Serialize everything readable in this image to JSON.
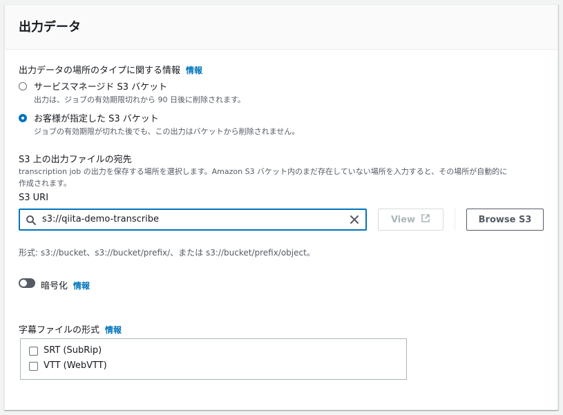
{
  "header": {
    "title": "出力データ"
  },
  "location": {
    "label": "出力データの場所のタイプに関する情報",
    "info": "情報",
    "options": [
      {
        "label": "サービスマネージド S3 バケット",
        "description": "出力は、ジョブの有効期限切れから 90 日後に削除されます。",
        "selected": false
      },
      {
        "label": "お客様が指定した S3 バケット",
        "description": "ジョブの有効期限が切れた後でも、この出力はバケットから削除されません。",
        "selected": true
      }
    ]
  },
  "destination": {
    "label": "S3 上の出力ファイルの宛先",
    "description_line1": "transcription job の出力を保存する場所を選択します。Amazon S3 バケット内のまだ存在していない場所を入力すると、その場所が自動的に",
    "description_line2": "作成されます。",
    "uri_label": "S3 URI",
    "uri_value": "s3://qiita-demo-transcribe",
    "view_label": "View",
    "browse_label": "Browse S3",
    "format_hint": "形式: s3://bucket、s3://bucket/prefix/、または s3://bucket/prefix/object。"
  },
  "encryption": {
    "label": "暗号化",
    "info": "情報",
    "enabled": false
  },
  "subtitles": {
    "label": "字幕ファイルの形式",
    "info": "情報",
    "options": [
      {
        "label": "SRT (SubRip)",
        "checked": false
      },
      {
        "label": "VTT (WebVTT)",
        "checked": false
      }
    ]
  },
  "colors": {
    "accent": "#0073bb",
    "text": "#16191f",
    "secondary_text": "#545b64"
  }
}
